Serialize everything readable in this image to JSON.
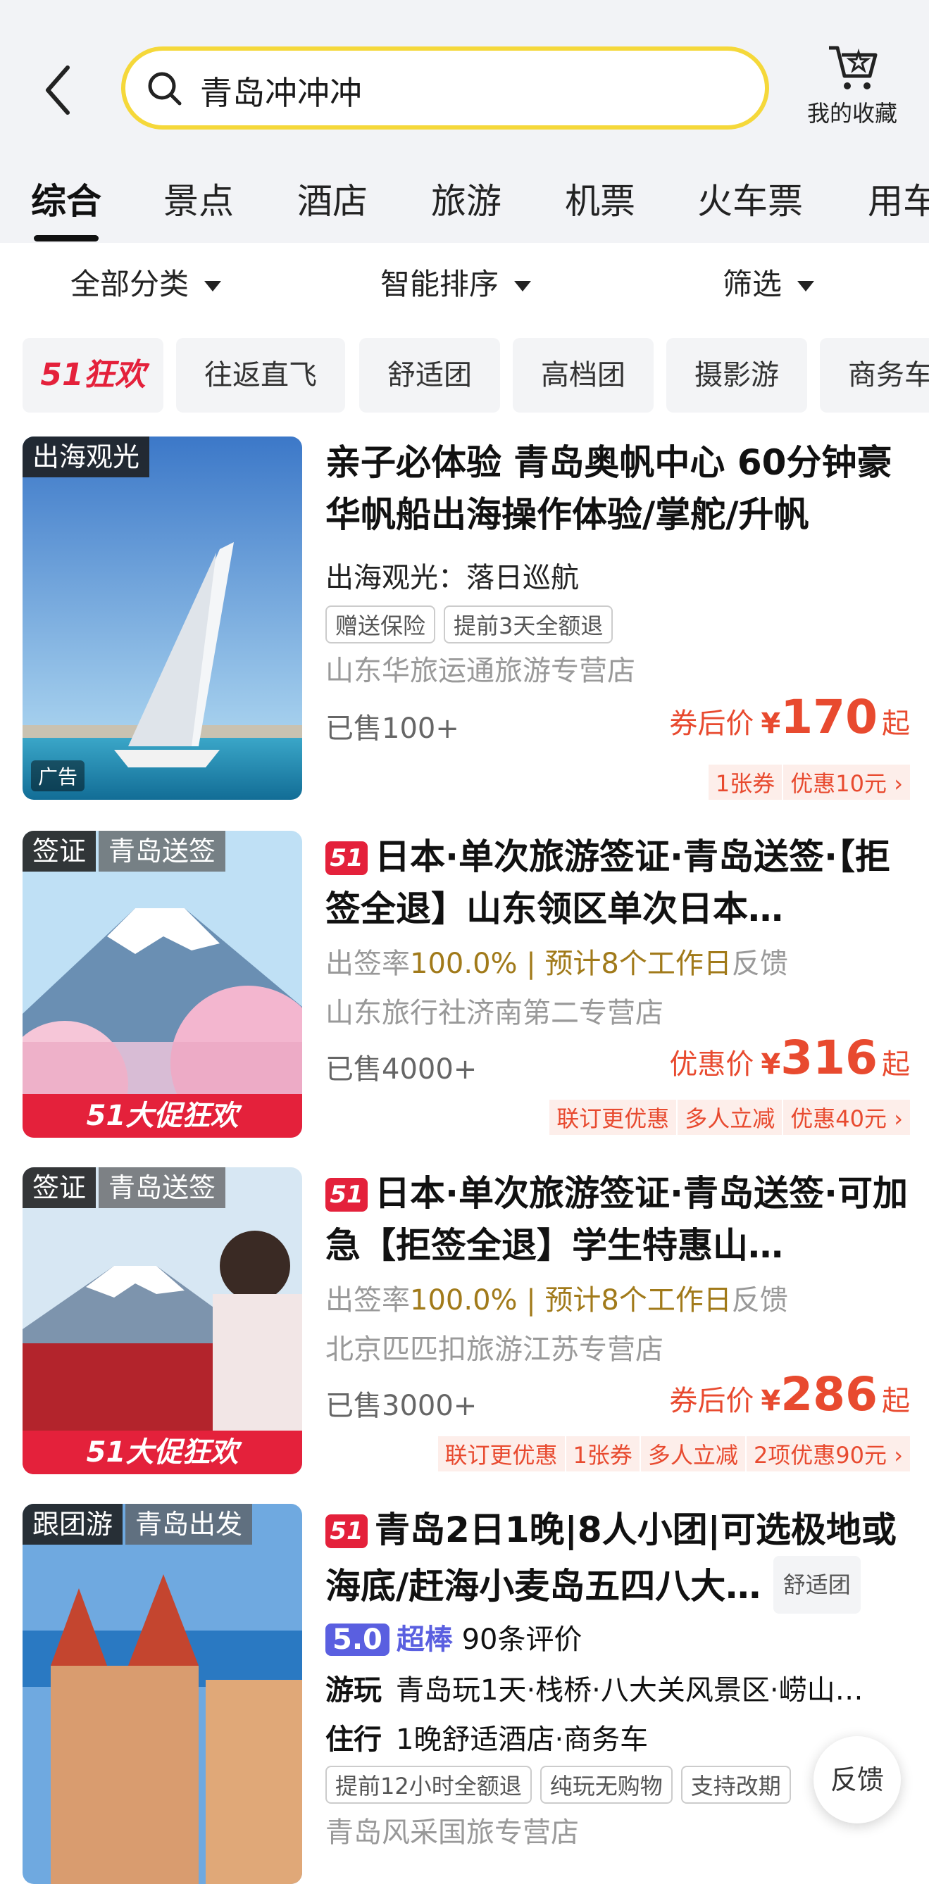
{
  "header": {
    "search_text": "青岛冲冲冲",
    "favorites_label": "我的收藏"
  },
  "tabs": [
    "综合",
    "景点",
    "酒店",
    "旅游",
    "机票",
    "火车票",
    "用车"
  ],
  "filters": [
    "全部分类",
    "智能排序",
    "筛选"
  ],
  "chips": [
    "51狂欢",
    "往返直飞",
    "舒适团",
    "高档团",
    "摄影游",
    "商务车"
  ],
  "results": [
    {
      "tag": "出海观光",
      "ad_label": "广告",
      "title": "亲子必体验 青岛奥帆中心 60分钟豪华帆船出海操作体验/掌舵/升帆",
      "subtitle": "出海观光：落日巡航",
      "pills": [
        "赠送保险",
        "提前3天全额退"
      ],
      "shop": "山东华旅运通旅游专营店",
      "sold": "已售100+",
      "price_label": "券后价",
      "currency": "¥",
      "price": "170",
      "price_suffix": "起",
      "coupons": [
        "1张券",
        "优惠10元 ›"
      ]
    },
    {
      "tag": "签证",
      "tag2": "青岛送签",
      "badge": "51",
      "title": "日本·单次旅游签证·青岛送签·【拒签全退】山东领区单次日本…",
      "rate_label": "出签率",
      "rate_value": "100.0%",
      "sep": " | ",
      "days": "预计8个工作日",
      "days_suffix": "反馈",
      "shop": "山东旅行社济南第二专营店",
      "sold": "已售4000+",
      "price_label": "优惠价",
      "currency": "¥",
      "price": "316",
      "price_suffix": "起",
      "coupons": [
        "联订更优惠",
        "多人立减",
        "优惠40元 ›"
      ],
      "banner": "51大促狂欢"
    },
    {
      "tag": "签证",
      "tag2": "青岛送签",
      "badge": "51",
      "title": "日本·单次旅游签证·青岛送签·可加急【拒签全退】学生特惠山…",
      "rate_label": "出签率",
      "rate_value": "100.0%",
      "sep": " | ",
      "days": "预计8个工作日",
      "days_suffix": "反馈",
      "shop": "北京匹匹扣旅游江苏专营店",
      "sold": "已售3000+",
      "price_label": "券后价",
      "currency": "¥",
      "price": "286",
      "price_suffix": "起",
      "coupons": [
        "联订更优惠",
        "1张券",
        "多人立减",
        "2项优惠90元 ›"
      ],
      "banner": "51大促狂欢"
    },
    {
      "tag": "跟团游",
      "tag2": "青岛出发",
      "badge": "51",
      "title": "青岛2日1晚|8人小团|可选极地或海底/赶海小麦岛五四八大…",
      "title_tag": "舒适团",
      "score": "5.0",
      "score_label": "超棒",
      "reviews": "90条评价",
      "play_label": "游玩",
      "play": "青岛玩1天·栈桥·八大关风景区·崂山…",
      "stay_label": "住行",
      "stay": "1晚舒适酒店·商务车",
      "pills": [
        "提前12小时全额退",
        "纯玩无购物",
        "支持改期"
      ],
      "shop": "青岛风采国旅专营店"
    }
  ],
  "feedback_label": "反馈",
  "colors": {
    "accent": "#e4213b",
    "price": "#e84a2f",
    "search_border": "#f5d83a",
    "rating": "#5a5fe0"
  }
}
